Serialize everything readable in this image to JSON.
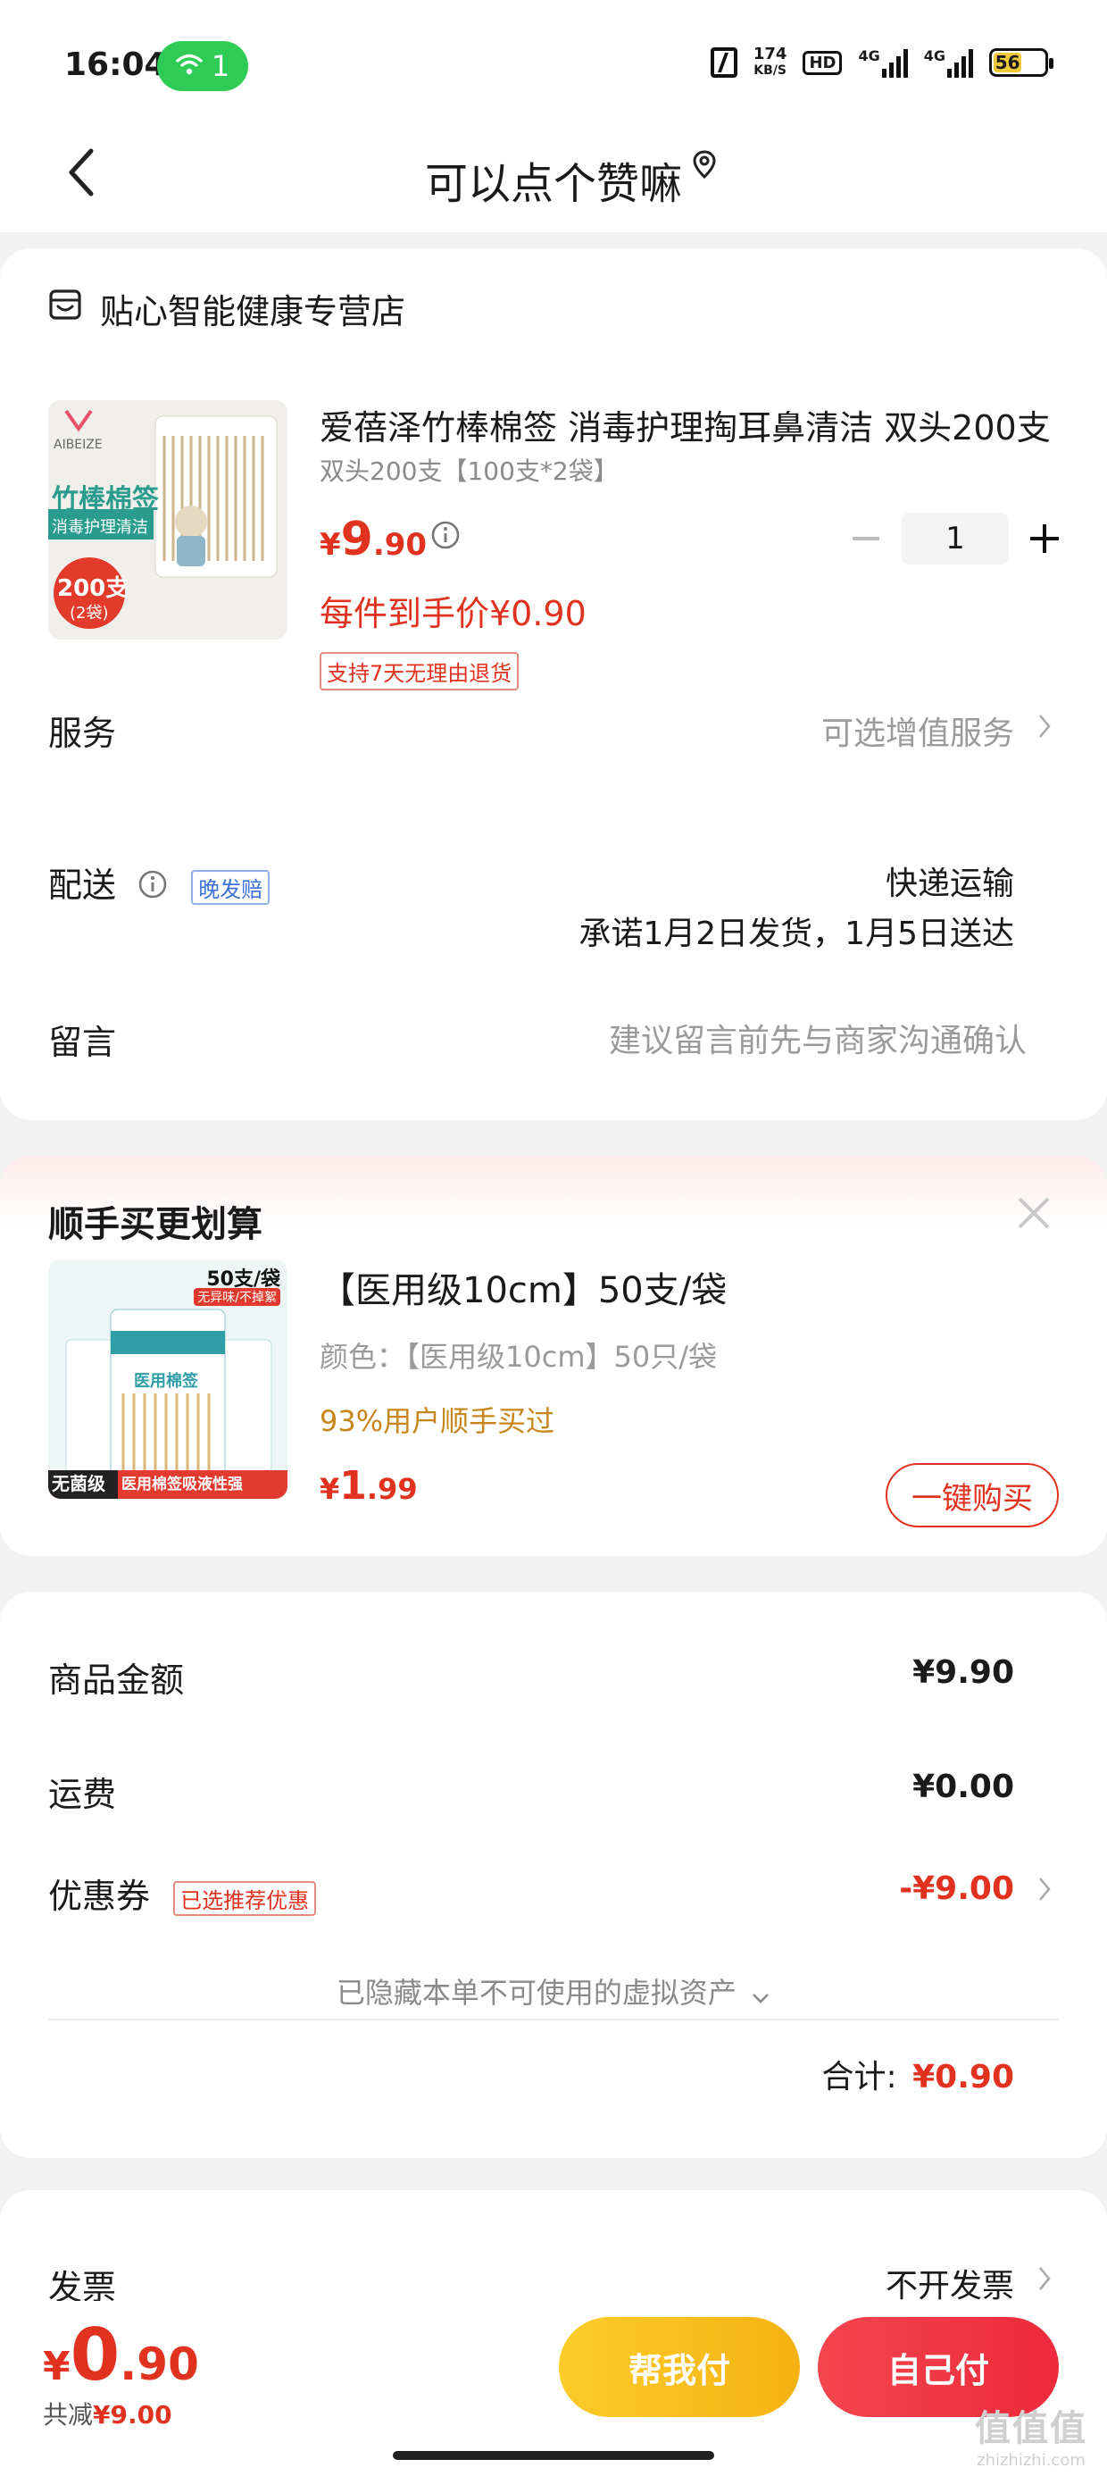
{
  "status_bar": {
    "time": "16:04",
    "wifi_badge": "1",
    "net_speed_value": "174",
    "net_speed_unit": "KB/S",
    "hd_label": "HD",
    "signal1_label": "4G",
    "signal2_label": "4G",
    "battery": "56"
  },
  "header": {
    "title": "可以点个赞嘛"
  },
  "store": {
    "name": "贴心智能健康专营店"
  },
  "product": {
    "image_brand": "AIBEIZE",
    "image_title": "竹棒棉签",
    "image_subtitle": "消毒护理清洁",
    "image_count": "200支",
    "image_count_sub": "(2袋)",
    "name": "爱蓓泽竹棒棉签 消毒护理掏耳鼻清洁 双头200支",
    "spec": "双头200支【100支*2袋】",
    "price_currency": "¥",
    "price_int": "9",
    "price_dec": ".90",
    "each_price": "每件到手价¥0.90",
    "return_policy": "支持7天无理由退货",
    "quantity": "1"
  },
  "service": {
    "label": "服务",
    "value": "可选增值服务"
  },
  "delivery": {
    "label": "配送",
    "tag": "晚发赔",
    "method": "快递运输",
    "promise": "承诺1月2日发货，1月5日送达"
  },
  "message": {
    "label": "留言",
    "placeholder": "建议留言前先与商家沟通确认"
  },
  "upsell": {
    "title": "顺手买更划算",
    "image_top": "50支/袋",
    "image_top_sub": "无异味/不掉絮",
    "image_pack": "医用棉签",
    "image_bottom_left": "无菌级",
    "image_bottom_right": "医用棉签吸液性强",
    "name": "【医用级10cm】50支/袋",
    "color": "颜色：【医用级10cm】50只/袋",
    "bought": "93%用户顺手买过",
    "price_currency": "¥",
    "price_int": "1",
    "price_dec": ".99",
    "buy_label": "一键购买"
  },
  "summary": {
    "goods_label": "商品金额",
    "goods_value": "¥9.90",
    "shipping_label": "运费",
    "shipping_value": "¥0.00",
    "coupon_label": "优惠券",
    "coupon_tag": "已选推荐优惠",
    "coupon_value": "-¥9.00",
    "hidden_assets": "已隐藏本单不可使用的虚拟资产",
    "total_label": "合计:",
    "total_value": "¥0.90"
  },
  "invoice": {
    "label": "发票",
    "value": "不开发票"
  },
  "bottom": {
    "currency": "¥",
    "int": "0",
    "dec": ".90",
    "saved_label": "共减",
    "saved_value": "¥9.00",
    "help_pay": "帮我付",
    "self_pay": "自己付"
  },
  "watermark": {
    "line1": "值值值",
    "line2": "zhizhizhi.com"
  },
  "colors": {
    "accent_red": "#e0321e",
    "upsell_orange": "#c8851c",
    "help_yellow": "#fcc72a",
    "self_red": "#f0384a",
    "status_green": "#2ecc55"
  }
}
